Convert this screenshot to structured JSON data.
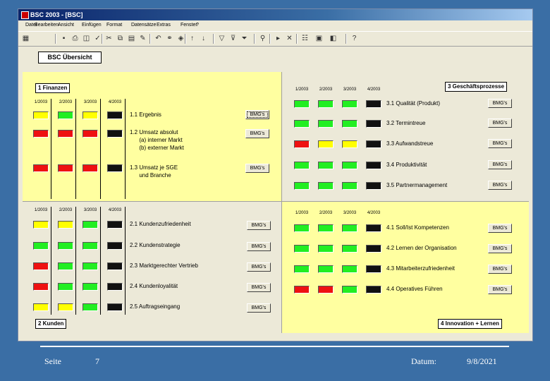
{
  "window": {
    "title": "BSC 2003 - [BSC]"
  },
  "menu": [
    "Datei",
    "Bearbeiten",
    "Ansicht",
    "Einfügen",
    "Format",
    "Datensätze",
    "Extras",
    "Fenster",
    "?"
  ],
  "toolbar_icons": [
    "design-view-icon",
    "save-icon",
    "print-icon",
    "print-preview-icon",
    "spellcheck-icon",
    "cut-icon",
    "copy-icon",
    "paste-icon",
    "format-painter-icon",
    "undo-icon",
    "insert-hyperlink-icon",
    "web-toolbar-icon",
    "sort-ascending-icon",
    "sort-descending-icon",
    "filter-by-selection-icon",
    "filter-by-form-icon",
    "apply-filter-icon",
    "find-icon",
    "new-record-icon",
    "delete-record-icon",
    "properties-icon",
    "database-window-icon",
    "new-object-icon",
    "help-icon"
  ],
  "overview_title": "BSC  Übersicht",
  "colors": {
    "green": "#22ee22",
    "red": "#ee1111",
    "yellow": "#ffff00",
    "black": "#111111"
  },
  "bmg_label": "BMG's",
  "quadrants": {
    "q1": {
      "label": "1 Finanzen",
      "periods": [
        "1/2003",
        "2/2003",
        "3/2003",
        "4/2003"
      ],
      "rows": [
        {
          "label": "1.1 Ergebnis",
          "status": [
            "yellow",
            "green",
            "yellow",
            "black"
          ]
        },
        {
          "label": "1.2 Umsatz absolut\n      (a) interner Markt\n      (b) externer Markt",
          "status": [
            "red",
            "red",
            "red",
            "black"
          ]
        },
        {
          "label": "1.3 Umsatz je SGE\n      und Branche",
          "status": [
            "red",
            "red",
            "red",
            "black"
          ]
        }
      ]
    },
    "q3": {
      "label": "3 Geschäftsprozesse",
      "periods": [
        "1/2003",
        "2/2003",
        "3/2003",
        "4/2003"
      ],
      "rows": [
        {
          "label": "3.1 Qualität (Produkt)",
          "status": [
            "green",
            "green",
            "green",
            "black"
          ]
        },
        {
          "label": "3.2 Termintreue",
          "status": [
            "green",
            "green",
            "green",
            "black"
          ]
        },
        {
          "label": "3.3 Aufwandstreue",
          "status": [
            "red",
            "yellow",
            "yellow",
            "black"
          ]
        },
        {
          "label": "3.4 Produktivität",
          "status": [
            "green",
            "green",
            "green",
            "black"
          ]
        },
        {
          "label": "3.5 Partnermanagement",
          "status": [
            "green",
            "green",
            "green",
            "black"
          ]
        }
      ]
    },
    "q2": {
      "label": "2 Kunden",
      "periods": [
        "1/2003",
        "2/2003",
        "3/2003",
        "4/2003"
      ],
      "rows": [
        {
          "label": "2.1 Kundenzufriedenheit",
          "status": [
            "yellow",
            "yellow",
            "green",
            "black"
          ]
        },
        {
          "label": "2.2 Kundenstrategie",
          "status": [
            "green",
            "green",
            "green",
            "black"
          ]
        },
        {
          "label": "2.3 Marktgerechter Vertrieb",
          "status": [
            "red",
            "green",
            "green",
            "black"
          ]
        },
        {
          "label": "2.4 Kundenloyalität",
          "status": [
            "red",
            "green",
            "green",
            "black"
          ]
        },
        {
          "label": "2.5 Auftragseingang",
          "status": [
            "yellow",
            "yellow",
            "green",
            "black"
          ]
        }
      ]
    },
    "q4": {
      "label": "4 Innovation + Lernen",
      "periods": [
        "1/2003",
        "2/2003",
        "3/2003",
        "4/2003"
      ],
      "rows": [
        {
          "label": "4.1 Soll/Ist Kompetenzen",
          "status": [
            "green",
            "green",
            "green",
            "black"
          ]
        },
        {
          "label": "4.2 Lernen der Organisation",
          "status": [
            "green",
            "green",
            "green",
            "black"
          ]
        },
        {
          "label": "4.3 Mitarbeiterzufriedenheit",
          "status": [
            "green",
            "green",
            "green",
            "black"
          ]
        },
        {
          "label": "4.4 Operatives Führen",
          "status": [
            "red",
            "red",
            "green",
            "black"
          ]
        }
      ]
    }
  },
  "footer": {
    "seite_label": "Seite",
    "seite_value": "7",
    "datum_label": "Datum:",
    "datum_value": "9/8/2021"
  }
}
